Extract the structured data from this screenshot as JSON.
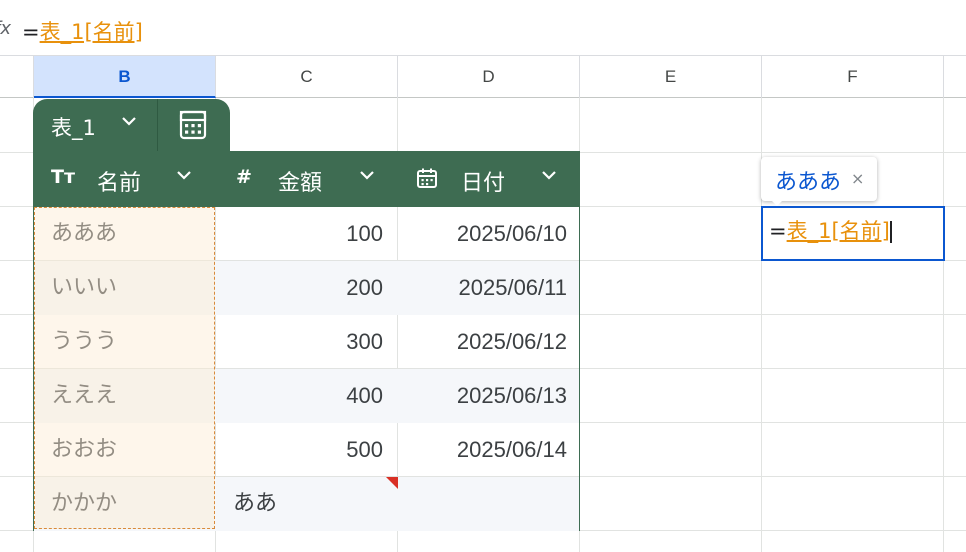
{
  "formula_bar": {
    "fx_icon": "fx",
    "eq": "=",
    "ref": "表_1[名前]"
  },
  "columns": [
    {
      "label": "B",
      "selected": true
    },
    {
      "label": "C"
    },
    {
      "label": "D"
    },
    {
      "label": "E"
    },
    {
      "label": "F"
    }
  ],
  "table": {
    "name": "表_1",
    "chevron": "⌄",
    "calc_icon": "calculator-icon",
    "headers": [
      {
        "icon_text": "Tт",
        "icon": "text-type-icon",
        "label": "名前"
      },
      {
        "icon_text": "#",
        "icon": "number-type-icon",
        "label": "金額"
      },
      {
        "icon_text": "▦",
        "icon": "calendar-icon",
        "label": "日付"
      }
    ],
    "rows": [
      {
        "name": "あああ",
        "amount": "100",
        "date": "2025/06/10"
      },
      {
        "name": "いいい",
        "amount": "200",
        "date": "2025/06/11"
      },
      {
        "name": "ううう",
        "amount": "300",
        "date": "2025/06/12"
      },
      {
        "name": "えええ",
        "amount": "400",
        "date": "2025/06/13"
      },
      {
        "name": "おおお",
        "amount": "500",
        "date": "2025/06/14"
      },
      {
        "name": "かかか",
        "amount": "ああ",
        "date": ""
      }
    ]
  },
  "chip": {
    "text": "あああ",
    "close": "×"
  },
  "editor": {
    "eq": "=",
    "ref": "表_1[名前]"
  },
  "colors": {
    "table_header": "#3e6c52",
    "ref_orange": "#e8910c",
    "selection_blue": "#0b57d0"
  }
}
